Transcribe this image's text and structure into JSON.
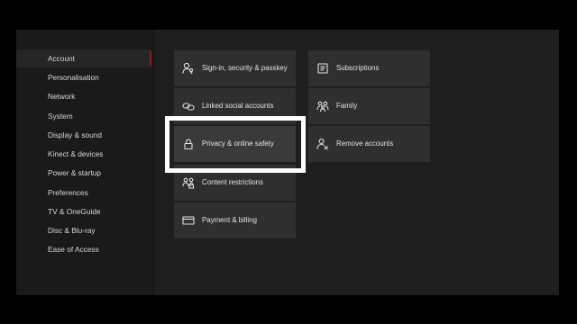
{
  "sidebar": {
    "items": [
      {
        "label": "Account"
      },
      {
        "label": "Personalisation"
      },
      {
        "label": "Network"
      },
      {
        "label": "System"
      },
      {
        "label": "Display & sound"
      },
      {
        "label": "Kinect & devices"
      },
      {
        "label": "Power & startup"
      },
      {
        "label": "Preferences"
      },
      {
        "label": "TV & OneGuide"
      },
      {
        "label": "Disc & Blu-ray"
      },
      {
        "label": "Ease of Access"
      }
    ],
    "selected": "Account"
  },
  "tiles": {
    "signin": {
      "label": "Sign-in, security & passkey",
      "icon": "person-key-icon"
    },
    "linked": {
      "label": "Linked social accounts",
      "icon": "link-icon"
    },
    "privacy": {
      "label": "Privacy & online safety",
      "icon": "lock-icon"
    },
    "content": {
      "label": "Content restrictions",
      "icon": "family-restriction-icon"
    },
    "payment": {
      "label": "Payment & billing",
      "icon": "credit-card-icon"
    },
    "subscriptions": {
      "label": "Subscriptions",
      "icon": "subscriptions-icon"
    },
    "family": {
      "label": "Family",
      "icon": "family-icon"
    },
    "remove": {
      "label": "Remove accounts",
      "icon": "remove-person-icon"
    }
  },
  "colors": {
    "background": "#1f1f1f",
    "sidebar": "#1a1a1a",
    "tile": "#2f2f2f",
    "accent": "#8a1f1f",
    "focus": "#ffffff"
  }
}
